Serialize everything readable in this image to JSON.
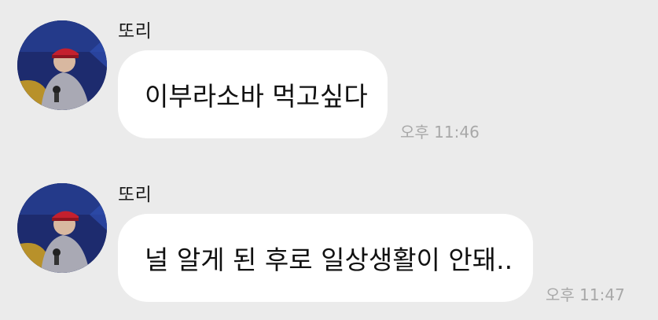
{
  "chat": {
    "messages": [
      {
        "sender": "또리",
        "text": "이부라소바 먹고싶다",
        "time": "오후 11:46"
      },
      {
        "sender": "또리",
        "text": "널 알게 된 후로 일상생활이 안돼..",
        "time": "오후 11:47"
      }
    ]
  },
  "colors": {
    "background": "#ebebeb",
    "bubble": "#ffffff",
    "timestamp": "#a8a8a8"
  }
}
